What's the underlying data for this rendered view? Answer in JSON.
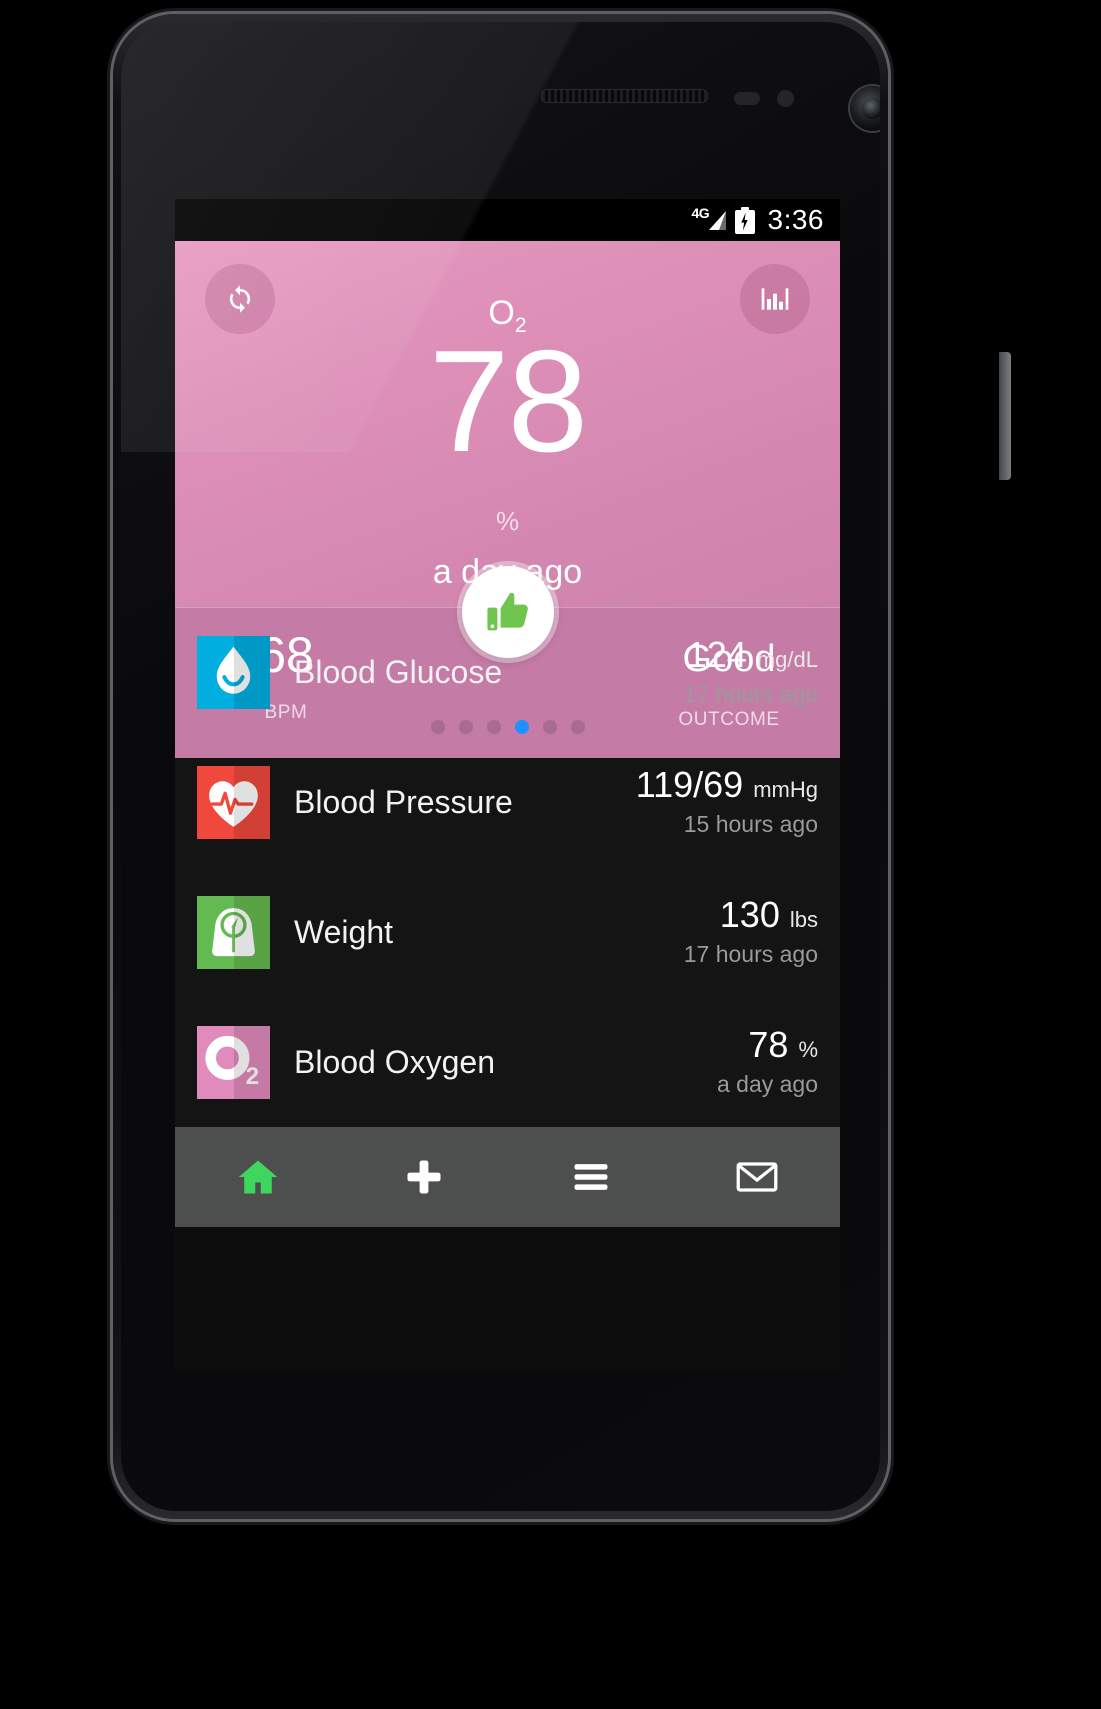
{
  "status_bar": {
    "network": "4G",
    "time": "3:36",
    "battery_icon": "battery-charging-icon",
    "signal_icon": "signal-bars-icon"
  },
  "hero": {
    "refresh_icon": "refresh-icon",
    "chart_icon": "bar-chart-icon",
    "metric_label": "O",
    "metric_sub": "2",
    "value": "78",
    "unit": "%",
    "timestamp": "a day ago",
    "accent_color": "#dd8fb7",
    "footer": {
      "left_value": "68",
      "left_label": "BPM",
      "right_value": "Good",
      "right_label": "OUTCOME",
      "thumb_icon": "thumbs-up-icon",
      "dots_total": 6,
      "dots_active_index": 3,
      "active_dot_color": "#1e90ff"
    }
  },
  "list": {
    "items": [
      {
        "name": "Blood Glucose",
        "icon": "blood-drop-icon",
        "icon_color": "#00aee0",
        "value": "124",
        "unit": "mg/dL",
        "timestamp": "17 hours ago"
      },
      {
        "name": "Blood Pressure",
        "icon": "heart-pulse-icon",
        "icon_color": "#f0483c",
        "value": "119/69",
        "unit": "mmHg",
        "timestamp": "15 hours ago"
      },
      {
        "name": "Weight",
        "icon": "weight-scale-icon",
        "icon_color": "#63ba50",
        "value": "130",
        "unit": "lbs",
        "timestamp": "17 hours ago"
      },
      {
        "name": "Blood Oxygen",
        "icon": "oxygen-o2-icon",
        "icon_color": "#e08bbb",
        "value": "78",
        "unit": "%",
        "timestamp": "a day ago"
      }
    ]
  },
  "bottom_nav": {
    "items": [
      {
        "icon": "home-icon",
        "color": "#3ed65c"
      },
      {
        "icon": "plus-icon",
        "color": "#ffffff"
      },
      {
        "icon": "menu-icon",
        "color": "#ffffff"
      },
      {
        "icon": "mail-icon",
        "color": "#ffffff"
      }
    ]
  }
}
